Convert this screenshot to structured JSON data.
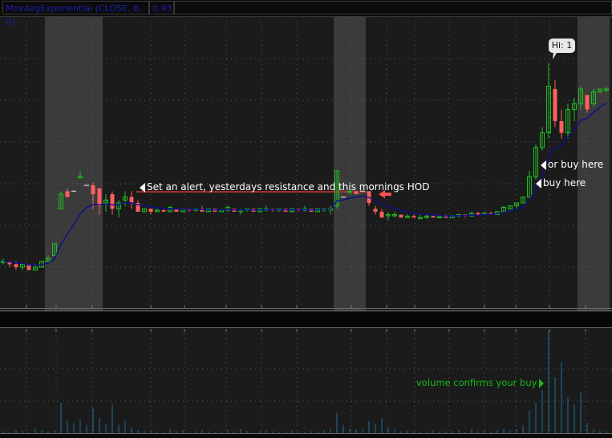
{
  "header": {
    "study_label": "MovAvgExponential (CLOSE, 8, 0)",
    "study_value": "0.93"
  },
  "colors": {
    "up": "#1ec21e",
    "down": "#ff6060",
    "ema": "#10108a",
    "volume": "#1f6f9a",
    "alert_line": "#a83232",
    "arrow": "#ff5050",
    "session_shade": "#3b3b3b"
  },
  "annotations": {
    "alert": "Set an alert, yesterdays resistance and this mornings HOD",
    "or_buy": "or buy here",
    "buy": "buy here",
    "hi_bubble": "Hi: 1",
    "volume": "volume confirms your buy"
  },
  "chart_data": {
    "type": "candlestick",
    "study": "EMA(close, 8)",
    "price_range": [
      0,
      100
    ],
    "volume_range": [
      0,
      100
    ],
    "alert_level": 39.8,
    "session_shading_bars": [
      [
        7,
        15
      ],
      [
        52,
        56
      ],
      [
        90,
        94
      ]
    ],
    "bars": [
      [
        16,
        17,
        15,
        16,
        2
      ],
      [
        16,
        16,
        14,
        15,
        1
      ],
      [
        15,
        16,
        13,
        14,
        3
      ],
      [
        14,
        15,
        13,
        15,
        2
      ],
      [
        15,
        15,
        13,
        13,
        1
      ],
      [
        13,
        15,
        13,
        14,
        4
      ],
      [
        14,
        16,
        14,
        16,
        3
      ],
      [
        16,
        18,
        16,
        17,
        2
      ],
      [
        18,
        22,
        18,
        22,
        3
      ],
      [
        34,
        40,
        34,
        39,
        30
      ],
      [
        40,
        41,
        38,
        38,
        12
      ],
      [
        40,
        40,
        40,
        40,
        10
      ],
      [
        45,
        47,
        45,
        45,
        14
      ],
      [
        42,
        42,
        42,
        42,
        8
      ],
      [
        42,
        43,
        34,
        39,
        25
      ],
      [
        41,
        41,
        32,
        35,
        15
      ],
      [
        36,
        39,
        33,
        37,
        9
      ],
      [
        39,
        40,
        32,
        34,
        28
      ],
      [
        34,
        37,
        31,
        36,
        8
      ],
      [
        37,
        40,
        35,
        38,
        12
      ],
      [
        38,
        40,
        34,
        36,
        6
      ],
      [
        36,
        37,
        33,
        33,
        3
      ],
      [
        33,
        34,
        33,
        34,
        2
      ],
      [
        34,
        34,
        32,
        33,
        3
      ],
      [
        33,
        34,
        33,
        33.5,
        2
      ],
      [
        33.5,
        34,
        33,
        33,
        1
      ],
      [
        33,
        35,
        33,
        34.5,
        4
      ],
      [
        34,
        34,
        33,
        33,
        2
      ],
      [
        33,
        34,
        33,
        34,
        3
      ],
      [
        34,
        34,
        33,
        33.5,
        1
      ],
      [
        33.5,
        34,
        33,
        34,
        2
      ],
      [
        34,
        35,
        33,
        33,
        3
      ],
      [
        33,
        34,
        33,
        34,
        2
      ],
      [
        34,
        34,
        33,
        33,
        1
      ],
      [
        33,
        34,
        33,
        33.5,
        2
      ],
      [
        33.5,
        35,
        33,
        34.5,
        3
      ],
      [
        34,
        34,
        33,
        33,
        2
      ],
      [
        33,
        34,
        32,
        33.5,
        4
      ],
      [
        33.5,
        34,
        33,
        34,
        2
      ],
      [
        34,
        34,
        33,
        33,
        1
      ],
      [
        33,
        34,
        33,
        34,
        2
      ],
      [
        34,
        35,
        33,
        34,
        3
      ],
      [
        34,
        34,
        33,
        33.5,
        2
      ],
      [
        33.5,
        34,
        33,
        34,
        1
      ],
      [
        34,
        34,
        33,
        33,
        2
      ],
      [
        33,
        34,
        33,
        34,
        3
      ],
      [
        34,
        34,
        33,
        33.5,
        2
      ],
      [
        33.5,
        35,
        33,
        34,
        1
      ],
      [
        34,
        34,
        33,
        33,
        2
      ],
      [
        33,
        34,
        33,
        34,
        2
      ],
      [
        34,
        34,
        33,
        34,
        3
      ],
      [
        34,
        35,
        32,
        34,
        4
      ],
      [
        35,
        47,
        34,
        47,
        20
      ],
      [
        38,
        38,
        38,
        38,
        8
      ],
      [
        40,
        41,
        39,
        40,
        5
      ],
      [
        40,
        40,
        39,
        39,
        4
      ],
      [
        40,
        40,
        40,
        40,
        4
      ],
      [
        40,
        40,
        35,
        36,
        12
      ],
      [
        34,
        35,
        32,
        33,
        9
      ],
      [
        33,
        34,
        31,
        31,
        15
      ],
      [
        32,
        33,
        30,
        32,
        6
      ],
      [
        32,
        33,
        31,
        32,
        4
      ],
      [
        32,
        32,
        31,
        31,
        2
      ],
      [
        31,
        32,
        31,
        31.5,
        3
      ],
      [
        31.5,
        32,
        31,
        31,
        2
      ],
      [
        31,
        32,
        31,
        31,
        1
      ],
      [
        31,
        32,
        30.5,
        31.5,
        2
      ],
      [
        31.5,
        32,
        31,
        31,
        3
      ],
      [
        31,
        31.5,
        31,
        31.3,
        1
      ],
      [
        31.3,
        32,
        31,
        31,
        2
      ],
      [
        31,
        32,
        31,
        31.5,
        2
      ],
      [
        31.5,
        32,
        31,
        32,
        3
      ],
      [
        32,
        32,
        31,
        31.5,
        1
      ],
      [
        31.5,
        33,
        31.5,
        32.5,
        4
      ],
      [
        32.5,
        33,
        32,
        32,
        2
      ],
      [
        32,
        33,
        32,
        32.5,
        3
      ],
      [
        32.5,
        33,
        32,
        32.3,
        2
      ],
      [
        32,
        33,
        32,
        33,
        3
      ],
      [
        33,
        35,
        33,
        34.5,
        4
      ],
      [
        34,
        35,
        34,
        35,
        3
      ],
      [
        35,
        36,
        34,
        36,
        4
      ],
      [
        36,
        38,
        36,
        38,
        8
      ],
      [
        38,
        47,
        38,
        45,
        22
      ],
      [
        45,
        56,
        44,
        55,
        30
      ],
      [
        55,
        62,
        54,
        60,
        42
      ],
      [
        60,
        84,
        58,
        76,
        100
      ],
      [
        75,
        78,
        62,
        64,
        55
      ],
      [
        64,
        68,
        58,
        60,
        70
      ],
      [
        60,
        70,
        58,
        68,
        35
      ],
      [
        68,
        72,
        64,
        70,
        28
      ],
      [
        70,
        76,
        68,
        75,
        40
      ],
      [
        73,
        73,
        67,
        68,
        10
      ],
      [
        70,
        75,
        69,
        74,
        4
      ],
      [
        74,
        75,
        74,
        75,
        2
      ],
      [
        75,
        76,
        74,
        75,
        2
      ]
    ]
  }
}
